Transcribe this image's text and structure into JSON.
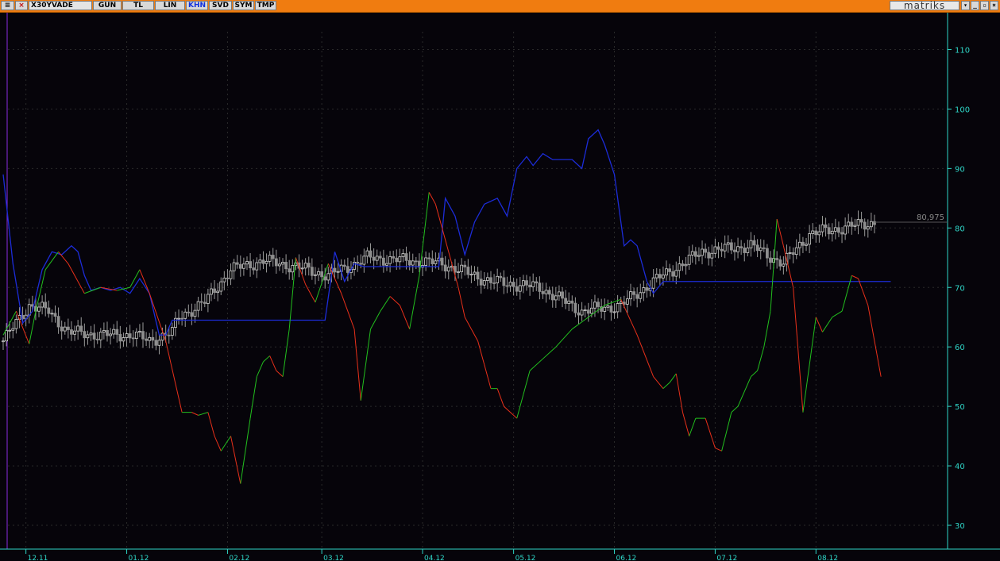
{
  "toolbar": {
    "symbol": "X30YVADE",
    "buttons": [
      "GUN",
      "TL",
      "LIN",
      "KHN",
      "SVD",
      "SYM",
      "TMP"
    ],
    "active_button": "KHN",
    "brand": "matriks",
    "window_controls": [
      "▾",
      "_",
      "▫",
      "×"
    ]
  },
  "colors": {
    "background": "#06040a",
    "axis": "#2fd6c8",
    "grid": "#2a2a2a",
    "candle_up": "#d0d0d0",
    "candle_down": "#8e8e8e",
    "stoch_up": "#22c01e",
    "stoch_down": "#e8301a",
    "blue_line": "#1c2cd8",
    "toolbar": "#f07c10"
  },
  "chart_data": {
    "type": "line",
    "ylim": [
      26,
      113
    ],
    "yticks": [
      30,
      40,
      50,
      60,
      70,
      80,
      90,
      100,
      110
    ],
    "last_value_label": "80,975",
    "x_count": 280,
    "xtick_labels": [
      "12.11",
      "01.12",
      "02.12",
      "03.12",
      "04.12",
      "05.12",
      "06.12",
      "07.12",
      "08.12"
    ],
    "xtick_index": [
      7,
      38,
      69,
      98,
      129,
      157,
      188,
      219,
      250
    ],
    "candles_close": [
      [
        0,
        61
      ],
      [
        8,
        67
      ],
      [
        14,
        66
      ],
      [
        20,
        62.5
      ],
      [
        30,
        62
      ],
      [
        40,
        62
      ],
      [
        45,
        61
      ],
      [
        52,
        62.5
      ],
      [
        54,
        65
      ],
      [
        62,
        67.5
      ],
      [
        70,
        73
      ],
      [
        80,
        74.5
      ],
      [
        90,
        73.5
      ],
      [
        100,
        72
      ],
      [
        112,
        75
      ],
      [
        125,
        74.5
      ],
      [
        135,
        74
      ],
      [
        150,
        71
      ],
      [
        165,
        70
      ],
      [
        178,
        66
      ],
      [
        190,
        67
      ],
      [
        200,
        71
      ],
      [
        215,
        76
      ],
      [
        230,
        77
      ],
      [
        240,
        74
      ],
      [
        248,
        79
      ],
      [
        258,
        80
      ],
      [
        268,
        80.975
      ]
    ],
    "stoch_line": [
      [
        0,
        62
      ],
      [
        4,
        66
      ],
      [
        8,
        60.5
      ],
      [
        10,
        66
      ],
      [
        13,
        73
      ],
      [
        17,
        76
      ],
      [
        20,
        74
      ],
      [
        25,
        69
      ],
      [
        30,
        70
      ],
      [
        35,
        69.5
      ],
      [
        39,
        70
      ],
      [
        42,
        73
      ],
      [
        45,
        69
      ],
      [
        50,
        61
      ],
      [
        55,
        49
      ],
      [
        58,
        49
      ],
      [
        60,
        48.5
      ],
      [
        63,
        49
      ],
      [
        65,
        45
      ],
      [
        67,
        42.5
      ],
      [
        70,
        45
      ],
      [
        73,
        37
      ],
      [
        76,
        48
      ],
      [
        78,
        55
      ],
      [
        80,
        57.5
      ],
      [
        82,
        58.5
      ],
      [
        84,
        56
      ],
      [
        86,
        55
      ],
      [
        88,
        63
      ],
      [
        90,
        75
      ],
      [
        93,
        70.5
      ],
      [
        96,
        67.5
      ],
      [
        100,
        74
      ],
      [
        104,
        69
      ],
      [
        108,
        63
      ],
      [
        110,
        51
      ],
      [
        113,
        63
      ],
      [
        116,
        66
      ],
      [
        119,
        68.5
      ],
      [
        122,
        67
      ],
      [
        125,
        63
      ],
      [
        128,
        72
      ],
      [
        131,
        86
      ],
      [
        133,
        84
      ],
      [
        135,
        80
      ],
      [
        137,
        76
      ],
      [
        140,
        70
      ],
      [
        142,
        65
      ],
      [
        144,
        63
      ],
      [
        146,
        61
      ],
      [
        148,
        57
      ],
      [
        150,
        53
      ],
      [
        152,
        53
      ],
      [
        154,
        50
      ],
      [
        158,
        48
      ],
      [
        160,
        52
      ],
      [
        162,
        56
      ],
      [
        166,
        58
      ],
      [
        170,
        60
      ],
      [
        175,
        63
      ],
      [
        180,
        65
      ],
      [
        185,
        67
      ],
      [
        190,
        68
      ],
      [
        195,
        62
      ],
      [
        200,
        55
      ],
      [
        203,
        53
      ],
      [
        205,
        54
      ],
      [
        207,
        55.5
      ],
      [
        209,
        49
      ],
      [
        211,
        45
      ],
      [
        213,
        48
      ],
      [
        216,
        48
      ],
      [
        219,
        43
      ],
      [
        221,
        42.5
      ],
      [
        224,
        49
      ],
      [
        226,
        50
      ],
      [
        230,
        55
      ],
      [
        232,
        56
      ],
      [
        234,
        60
      ],
      [
        236,
        66
      ],
      [
        238,
        81.5
      ],
      [
        240,
        77
      ],
      [
        243,
        70
      ],
      [
        246,
        49
      ],
      [
        250,
        65
      ],
      [
        252,
        62.5
      ],
      [
        255,
        65
      ],
      [
        258,
        66
      ],
      [
        261,
        72
      ],
      [
        263,
        71.5
      ],
      [
        266,
        67
      ],
      [
        270,
        55
      ]
    ],
    "blue_line": [
      [
        0,
        89
      ],
      [
        3,
        74
      ],
      [
        6,
        64
      ],
      [
        9,
        66
      ],
      [
        12,
        73
      ],
      [
        15,
        76
      ],
      [
        18,
        75.5
      ],
      [
        21,
        77
      ],
      [
        23,
        76
      ],
      [
        25,
        72
      ],
      [
        27,
        69.5
      ],
      [
        30,
        70
      ],
      [
        33,
        69.5
      ],
      [
        36,
        70
      ],
      [
        39,
        69
      ],
      [
        42,
        71.5
      ],
      [
        45,
        69
      ],
      [
        48,
        62
      ],
      [
        50,
        62
      ],
      [
        52,
        64.5
      ],
      [
        99,
        64.5
      ],
      [
        102,
        76
      ],
      [
        105,
        71
      ],
      [
        108,
        74
      ],
      [
        111,
        73.5
      ],
      [
        114,
        73.5
      ],
      [
        134,
        73.5
      ],
      [
        136,
        85
      ],
      [
        139,
        82
      ],
      [
        142,
        75.5
      ],
      [
        145,
        81
      ],
      [
        148,
        84
      ],
      [
        152,
        85
      ],
      [
        155,
        82
      ],
      [
        158,
        90
      ],
      [
        161,
        92
      ],
      [
        163,
        90.5
      ],
      [
        166,
        92.5
      ],
      [
        169,
        91.5
      ],
      [
        172,
        91.5
      ],
      [
        175,
        91.5
      ],
      [
        178,
        90
      ],
      [
        180,
        95
      ],
      [
        183,
        96.5
      ],
      [
        185,
        94
      ],
      [
        188,
        89
      ],
      [
        191,
        77
      ],
      [
        193,
        78
      ],
      [
        195,
        77
      ],
      [
        198,
        71
      ],
      [
        200,
        69
      ],
      [
        203,
        71
      ],
      [
        273,
        71
      ]
    ]
  }
}
